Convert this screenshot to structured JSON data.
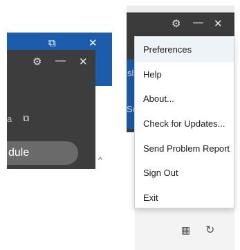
{
  "left_window": {
    "maximize_glyph": "⧉",
    "minimize_glyph": "—",
    "close_glyph": "✕",
    "settings_glyph": "⚙",
    "copy_glyph": "⧉",
    "text_fragment": "a",
    "module_label": "dule",
    "chevron_glyph": "^"
  },
  "right_window": {
    "settings_glyph": "⚙",
    "minimize_glyph": "—",
    "close_glyph": "✕",
    "edge_text_1": "sl",
    "edge_text_2": "Sc"
  },
  "menu": {
    "items": [
      {
        "label": "Preferences"
      },
      {
        "label": "Help"
      },
      {
        "label": "About..."
      },
      {
        "label": "Check for Updates..."
      },
      {
        "label": "Send Problem Report"
      },
      {
        "label": "Sign Out"
      },
      {
        "label": "Exit"
      }
    ]
  },
  "bottom_icons": {
    "calendar_glyph": "▦",
    "refresh_glyph": "↻"
  },
  "colors": {
    "title_blue": "#1b5dac",
    "dark_bg": "#3d3d3d",
    "menu_bg": "#ffffff",
    "menu_highlight": "#eef3f8"
  }
}
